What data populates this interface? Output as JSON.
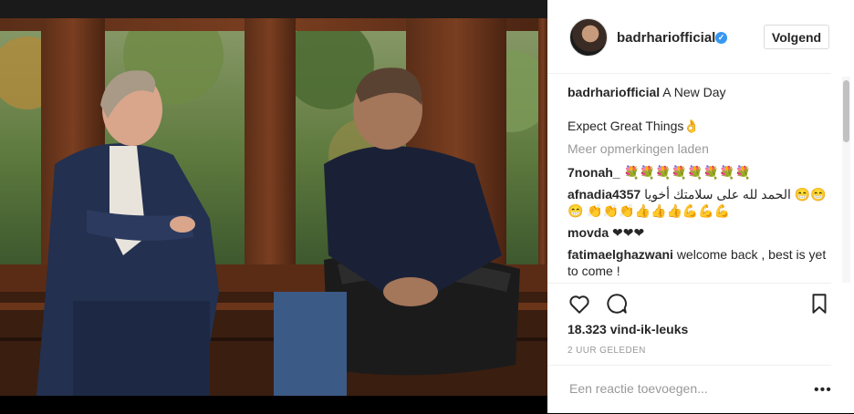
{
  "post": {
    "username": "badrhariofficial",
    "follow_label": "Volgend",
    "caption_text": "A New Day",
    "caption_line2": "Expect Great Things👌",
    "load_more": "Meer opmerkingen laden",
    "comments": [
      {
        "user": "7nonah_",
        "text": "💐💐💐💐💐💐💐💐"
      },
      {
        "user": "afnadia4357",
        "text": "الحمد لله على سلامتك أخويا 😁😁😁 👏👏👏👍👍👍💪💪💪"
      },
      {
        "user": "movda",
        "text": "❤❤❤"
      },
      {
        "user": "fatimaelghazwani",
        "text": "welcome back , best is yet to come !"
      }
    ],
    "likes": "18.323 vind-ik-leuks",
    "time_ago": "2 UUR GELEDEN",
    "add_comment_placeholder": "Een reactie toevoegen..."
  },
  "icons": {
    "verified": "verified-badge-icon",
    "like": "heart-icon",
    "comment": "comment-bubble-icon",
    "save": "bookmark-icon",
    "more": "more-options-icon"
  },
  "colors": {
    "verified_blue": "#3897f0",
    "muted_text": "#999999",
    "border": "#efefef"
  }
}
